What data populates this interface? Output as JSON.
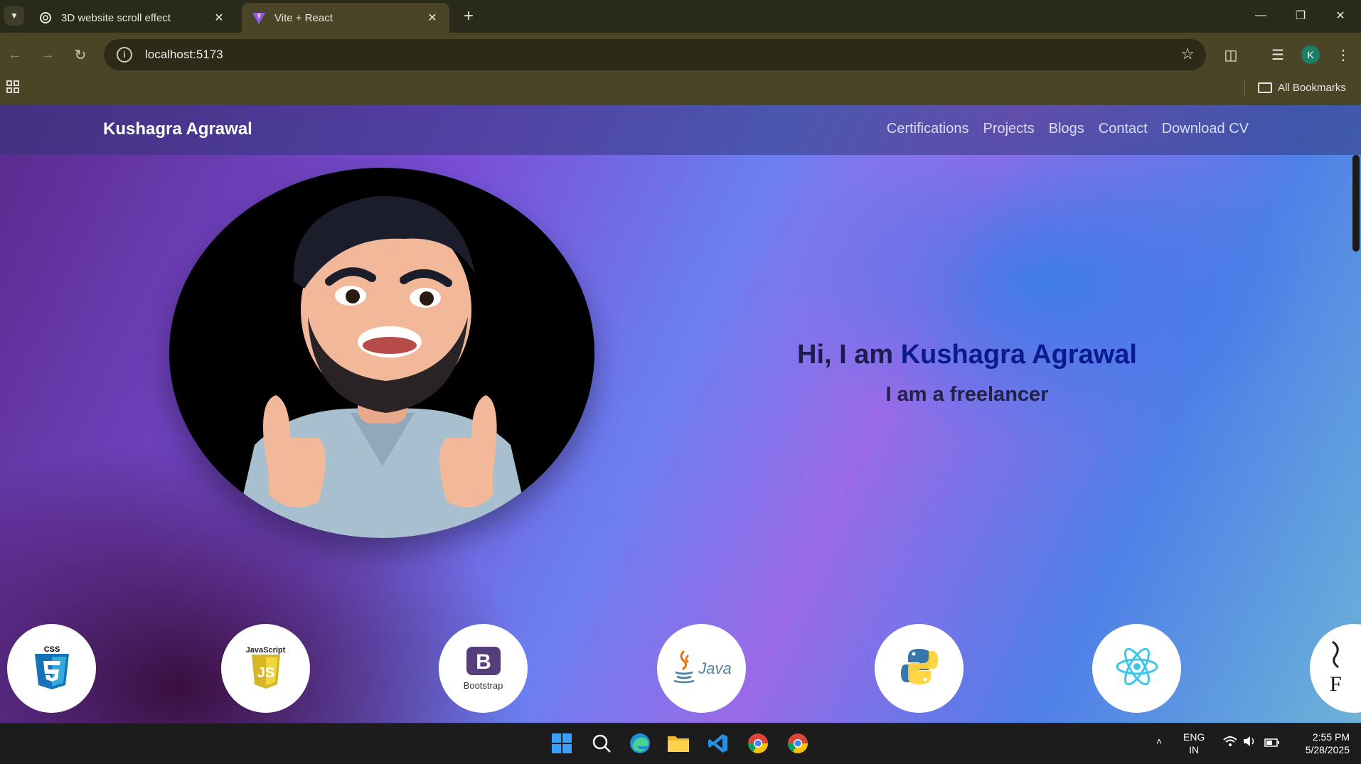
{
  "browser": {
    "tabs": [
      {
        "title": "3D website scroll effect",
        "active": false
      },
      {
        "title": "Vite + React",
        "active": true
      }
    ],
    "new_tab_label": "+",
    "address": "localhost:5173",
    "bookmarks_label": "All Bookmarks",
    "profile_initial": "K"
  },
  "site": {
    "brand": "Kushagra Agrawal",
    "nav": [
      "Certifications",
      "Projects",
      "Blogs",
      "Contact",
      "Download CV"
    ],
    "hero": {
      "greeting": "Hi, I am ",
      "name": "Kushagra Agrawal",
      "subtitle": "I am a freelancer"
    },
    "skills": [
      {
        "name": "css3-icon",
        "label": "CSS"
      },
      {
        "name": "javascript-icon",
        "label": "JavaScript"
      },
      {
        "name": "bootstrap-icon",
        "label": "Bootstrap"
      },
      {
        "name": "java-icon",
        "label": "Java"
      },
      {
        "name": "python-icon",
        "label": ""
      },
      {
        "name": "react-icon",
        "label": ""
      },
      {
        "name": "flask-icon",
        "label": "F"
      }
    ]
  },
  "taskbar": {
    "language": "ENG",
    "region": "IN",
    "time": "2:55 PM",
    "date": "5/28/2025"
  },
  "colors": {
    "hero_name": "#0c1a8f",
    "tab_bar": "#2a2a1a",
    "toolbar": "#4a4526"
  }
}
